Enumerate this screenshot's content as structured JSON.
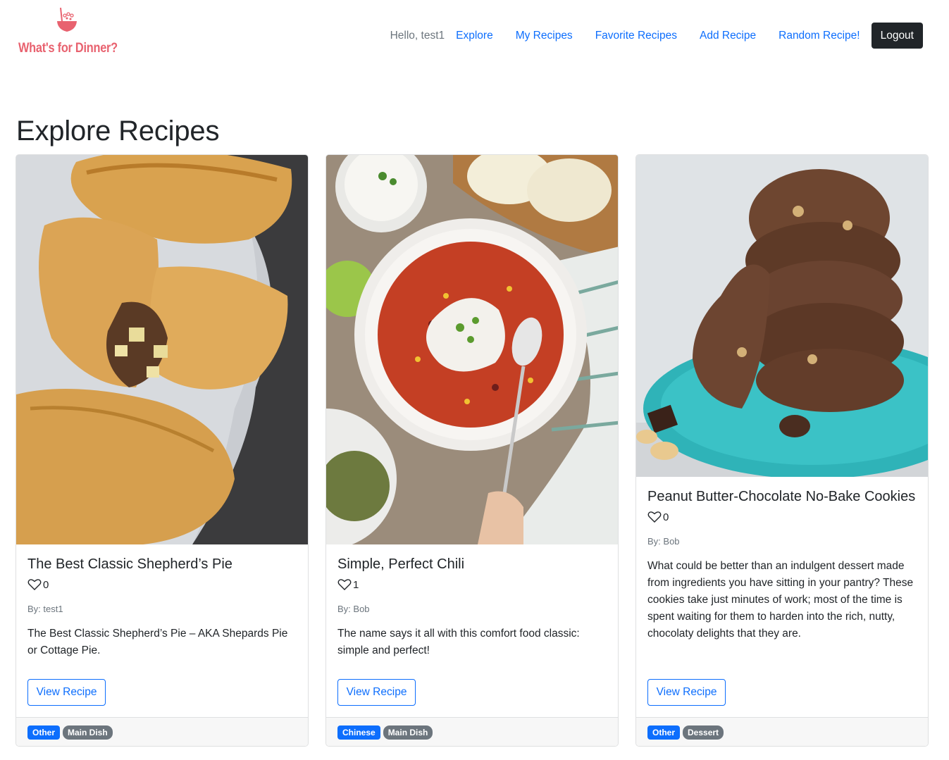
{
  "brand": {
    "name": "What's for Dinner?",
    "icon": "soup-bowl-icon",
    "color": "#e8626f"
  },
  "nav": {
    "greeting": "Hello, test1",
    "links": [
      "Explore",
      "My Recipes",
      "Favorite Recipes",
      "Add Recipe",
      "Random Recipe!"
    ],
    "logout": "Logout"
  },
  "page": {
    "title": "Explore Recipes"
  },
  "recipes": [
    {
      "title": "The Best Classic Shepherd’s Pie",
      "likes": "0",
      "author": "By: test1",
      "description": "The Best Classic Shepherd’s Pie – AKA Shepards Pie or Cottage Pie.",
      "button": "View Recipe",
      "tags": [
        "Other",
        "Main Dish"
      ],
      "image": "pasties-photo"
    },
    {
      "title": "Simple, Perfect Chili",
      "likes": "1",
      "author": "By: Bob",
      "description": "The name says it all with this comfort food classic: simple and perfect!",
      "button": "View Recipe",
      "tags": [
        "Chinese",
        "Main Dish"
      ],
      "image": "chili-bowl-photo"
    },
    {
      "title": "Peanut Butter-Chocolate No-Bake Cookies",
      "likes": "0",
      "author": "By: Bob",
      "description": "What could be better than an indulgent dessert made from ingredients you have sitting in your pantry? These cookies take just minutes of work; most of the time is spent waiting for them to harden into the rich, nutty, chocolaty delights that they are.",
      "button": "View Recipe",
      "tags": [
        "Other",
        "Dessert"
      ],
      "image": "cookies-photo"
    }
  ],
  "colors": {
    "link": "#0d6efd",
    "dark": "#212529",
    "muted": "#6c757d",
    "badgeBlue": "#0d6efd",
    "badgeGray": "#6c757d"
  }
}
